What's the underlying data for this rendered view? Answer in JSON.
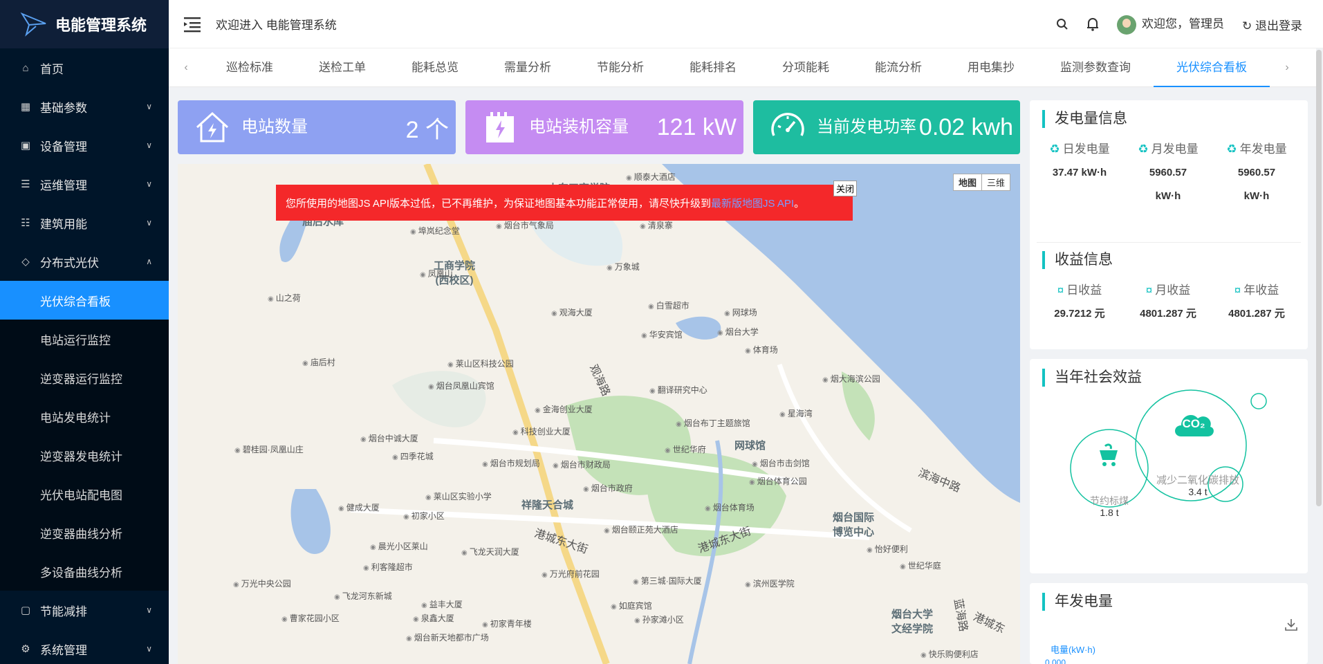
{
  "app": {
    "title": "电能管理系统"
  },
  "header": {
    "welcome": "欢迎进入 电能管理系统",
    "greeting": "欢迎您，管理员",
    "logout": "退出登录"
  },
  "sidebar": {
    "items": [
      {
        "label": "首页",
        "icon": "home-icon"
      },
      {
        "label": "基础参数",
        "icon": "grid-icon"
      },
      {
        "label": "设备管理",
        "icon": "device-icon"
      },
      {
        "label": "运维管理",
        "icon": "list-icon"
      },
      {
        "label": "建筑用能",
        "icon": "building-icon"
      },
      {
        "label": "分布式光伏",
        "icon": "solar-icon"
      },
      {
        "label": "节能减排",
        "icon": "leaf-icon"
      },
      {
        "label": "系统管理",
        "icon": "gear-icon"
      }
    ],
    "sub_items": [
      "光伏综合看板",
      "电站运行监控",
      "逆变器运行监控",
      "电站发电统计",
      "逆变器发电统计",
      "光伏电站配电图",
      "逆变器曲线分析",
      "多设备曲线分析"
    ]
  },
  "tabs": [
    "巡检标准",
    "送检工单",
    "能耗总览",
    "需量分析",
    "节能分析",
    "能耗排名",
    "分项能耗",
    "能流分析",
    "用电集抄",
    "监测参数查询",
    "光伏综合看板"
  ],
  "cards": {
    "station_count": {
      "label": "电站数量",
      "value": "2 个",
      "color": "#8ea1f2"
    },
    "capacity": {
      "label": "电站装机容量",
      "value": "121 kW",
      "color": "#c58cf2"
    },
    "power": {
      "label": "当前发电功率",
      "value": "0.02 kwh",
      "color": "#1ebda0"
    }
  },
  "map": {
    "toggle": [
      "地图",
      "三维"
    ],
    "warning": "您所使用的地图JS API版本过低，已不再维护，为保证地图基本功能正常使用，请尽快升级到",
    "warning_link": "最新版地图JS API",
    "warning_end": "。",
    "close": "关闭",
    "areas": [
      "庙后水库",
      "工商学院\n(西校区)",
      "网球馆",
      "祥隆天合城",
      "烟台国际\n博览中心",
      "烟台大学\n文经学院",
      "山东工商学院"
    ],
    "roads": [
      "观海路",
      "港城东大街",
      "港城东大街",
      "滨海中路",
      "蓝海路",
      "港城东"
    ],
    "pois": [
      "顺泰大酒店",
      "烟台市气象局",
      "清泉寨",
      "凤凰山",
      "万象城",
      "山之荷",
      "观海大厦",
      "白雪超市",
      "网球场",
      "华安宾馆",
      "烟台大学",
      "体育场",
      "莱山区科技公园",
      "烟台凤凰山宾馆",
      "翻译研究中心",
      "烟大海滨公园",
      "金海创业大厦",
      "烟台布丁主题旅馆",
      "星海湾",
      "烟台中诚大厦",
      "科技创业大厦",
      "世纪华府",
      "四季花城",
      "烟台市规划局",
      "烟台市财政局",
      "烟台市击剑馆",
      "烟台体育公园",
      "莱山区实验小学",
      "烟台市政府",
      "健成大厦",
      "初家小区",
      "烟台体育场",
      "烟台颐正苑大酒店",
      "晨光小区莱山",
      "飞龙天润大厦",
      "怡好便利",
      "世纪华庭",
      "利客隆超市",
      "万光府前花园",
      "万光中央公园",
      "第三城·国际大厦",
      "滨州医学院",
      "飞龙河东新城",
      "益丰大厦",
      "如庭宾馆",
      "曹家花园小区",
      "泉鑫大厦",
      "初家青年楼",
      "孙家滩小区",
      "烟台新天地都市广场",
      "快乐购便利店",
      "埠岚纪念堂",
      "碧桂园·凤凰山庄",
      "庙后村"
    ]
  },
  "generation": {
    "title": "发电量信息",
    "items": [
      {
        "label": "日发电量",
        "value": "37.47 kW·h"
      },
      {
        "label": "月发电量",
        "value": "5960.57",
        "unit": "kW·h"
      },
      {
        "label": "年发电量",
        "value": "5960.57",
        "unit": "kW·h"
      }
    ]
  },
  "income": {
    "title": "收益信息",
    "items": [
      {
        "label": "日收益",
        "value": "29.7212 元"
      },
      {
        "label": "月收益",
        "value": "4801.287 元"
      },
      {
        "label": "年收益",
        "value": "4801.287 元"
      }
    ]
  },
  "social": {
    "title": "当年社会效益",
    "coal_label": "节约标煤",
    "coal_value": "1.8 t",
    "co2_label": "减少二氧化碳排放",
    "co2_value": "3.4 t",
    "co2_badge": "CO₂"
  },
  "annual": {
    "title": "年发电量",
    "ylabel": "电量(kW·h)",
    "tick_top": "0.000"
  }
}
